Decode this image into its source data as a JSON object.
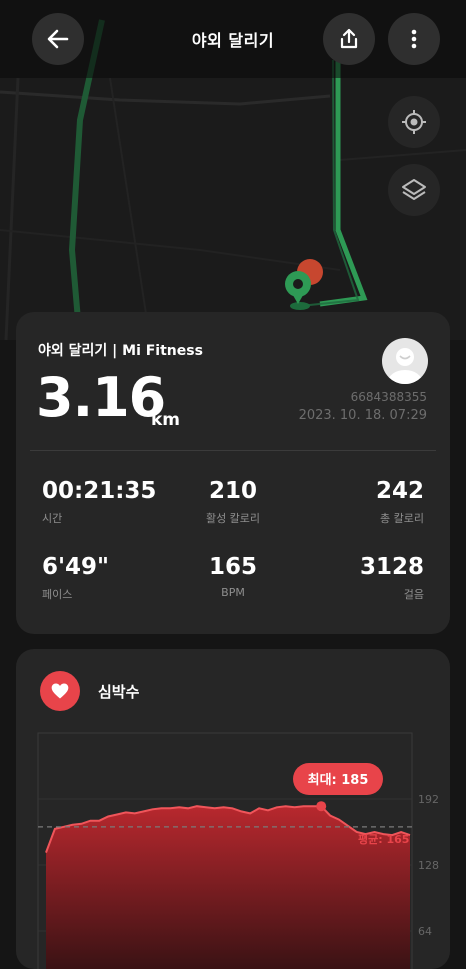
{
  "header": {
    "title": "야외 달리기"
  },
  "icons": {
    "back": "back-arrow-icon",
    "share": "share-icon",
    "more": "more-vertical-icon",
    "locate": "locate-icon",
    "layers": "layers-icon",
    "heart": "heart-icon"
  },
  "summary": {
    "source": "야외 달리기 | Mi Fitness",
    "distance": "3.16",
    "unit": "km",
    "user_id": "6684388355",
    "datetime": "2023. 10. 18. 07:29"
  },
  "stats": [
    {
      "value": "00:21:35",
      "label": "시간"
    },
    {
      "value": "210",
      "label": "활성 칼로리"
    },
    {
      "value": "242",
      "label": "총 칼로리"
    },
    {
      "value": "6'49\"",
      "label": "페이스"
    },
    {
      "value": "165",
      "label": "BPM"
    },
    {
      "value": "3128",
      "label": "걸음"
    }
  ],
  "heart_rate": {
    "title": "심박수",
    "max_label": "최대: 185",
    "avg_label": "평균: 165"
  },
  "colors": {
    "accent": "#e8444a",
    "route": "#2e9a55",
    "card": "#262626"
  },
  "chart_data": {
    "type": "area",
    "y_ticks": [
      "192",
      "128",
      "64"
    ],
    "ylim": [
      64,
      192
    ],
    "max": 185,
    "avg": 165,
    "values": [
      140,
      163,
      165,
      167,
      168,
      171,
      171,
      175,
      177,
      179,
      178,
      180,
      182,
      183,
      183,
      184,
      183,
      185,
      184,
      183,
      184,
      183,
      180,
      178,
      183,
      181,
      184,
      185,
      184,
      185,
      185,
      185,
      176,
      172,
      166,
      160,
      158,
      160,
      158,
      157,
      160,
      157
    ]
  }
}
